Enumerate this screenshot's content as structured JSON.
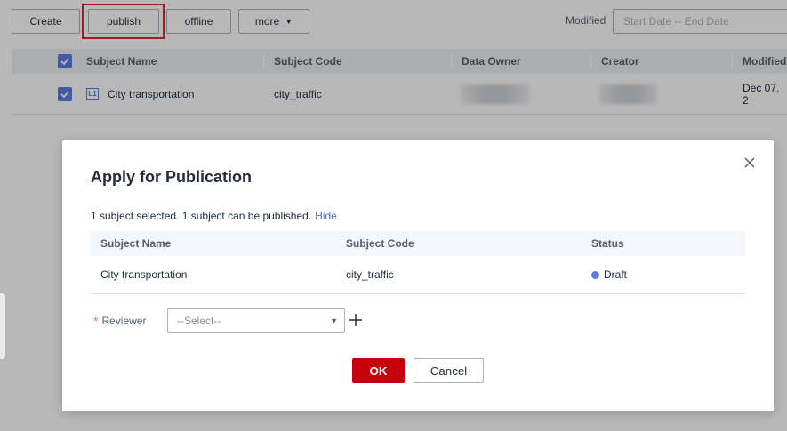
{
  "toolbar": {
    "create_label": "Create",
    "publish_label": "publish",
    "offline_label": "offline",
    "more_label": "more",
    "modified_label": "Modified",
    "date_placeholder": "Start Date -- End Date"
  },
  "grid": {
    "columns": [
      "Subject Name",
      "Subject Code",
      "Data Owner",
      "Creator",
      "Modified"
    ],
    "rows": [
      {
        "level": "L1",
        "name": "City transportation",
        "code": "city_traffic",
        "modified": "Dec 07, 2"
      }
    ]
  },
  "dialog": {
    "title": "Apply for Publication",
    "summary": "1 subject selected. 1 subject can be published.",
    "hide_link": "Hide",
    "columns": [
      "Subject Name",
      "Subject Code",
      "Status"
    ],
    "rows": [
      {
        "name": "City transportation",
        "code": "city_traffic",
        "status": "Draft"
      }
    ],
    "reviewer_label": "Reviewer",
    "reviewer_placeholder": "--Select--",
    "ok_label": "OK",
    "cancel_label": "Cancel"
  },
  "colors": {
    "accent": "#5e7ce0",
    "primary_button": "#c7000b",
    "highlight_box": "#e0262b",
    "status_draft": "#5e7ce0"
  }
}
